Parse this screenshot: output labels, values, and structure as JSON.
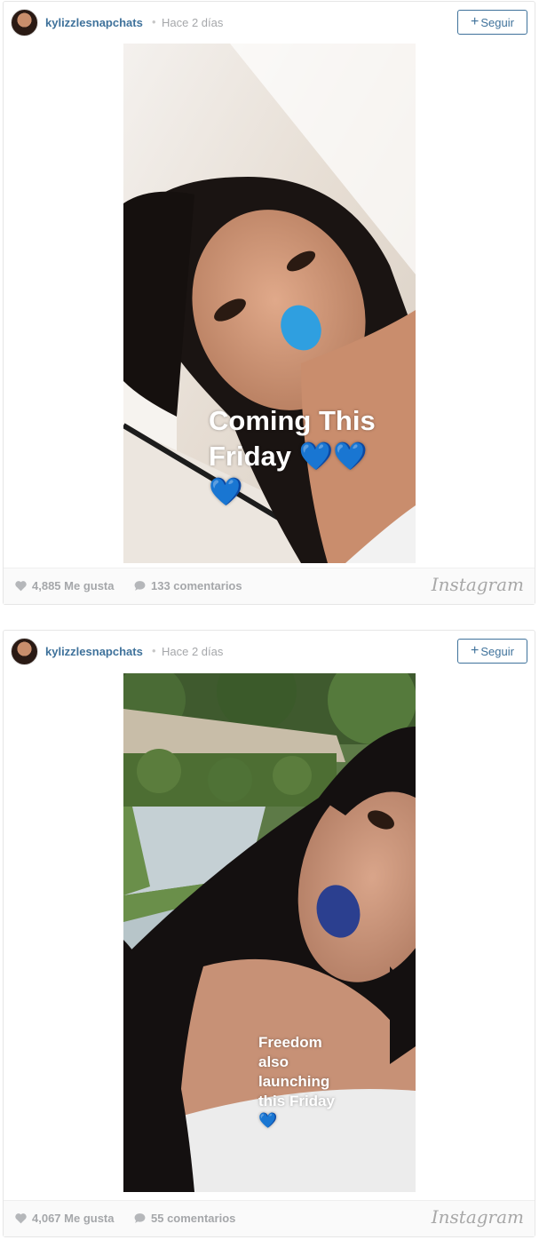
{
  "posts": [
    {
      "username": "kylizzlesnapchats",
      "separator": "•",
      "time": "Hace 2 días",
      "follow_label": "Seguir",
      "follow_icon": "plus-icon",
      "caption_lines": [
        "Coming This",
        "Friday 💙💙",
        "💙"
      ],
      "likes": "4,885 Me gusta",
      "comments": "133 comentarios",
      "brand": "Instagram"
    },
    {
      "username": "kylizzlesnapchats",
      "separator": "•",
      "time": "Hace 2 días",
      "follow_label": "Seguir",
      "follow_icon": "plus-icon",
      "caption_lines": [
        "Freedom",
        "also",
        "launching",
        "this Friday",
        "💙"
      ],
      "likes": "4,067 Me gusta",
      "comments": "55 comentarios",
      "brand": "Instagram"
    }
  ],
  "colors": {
    "link_blue": "#3f729b",
    "muted_gray": "#a5a7aa",
    "lip_blue_1": "#2f9fe0",
    "lip_blue_2": "#2b3f8f"
  }
}
